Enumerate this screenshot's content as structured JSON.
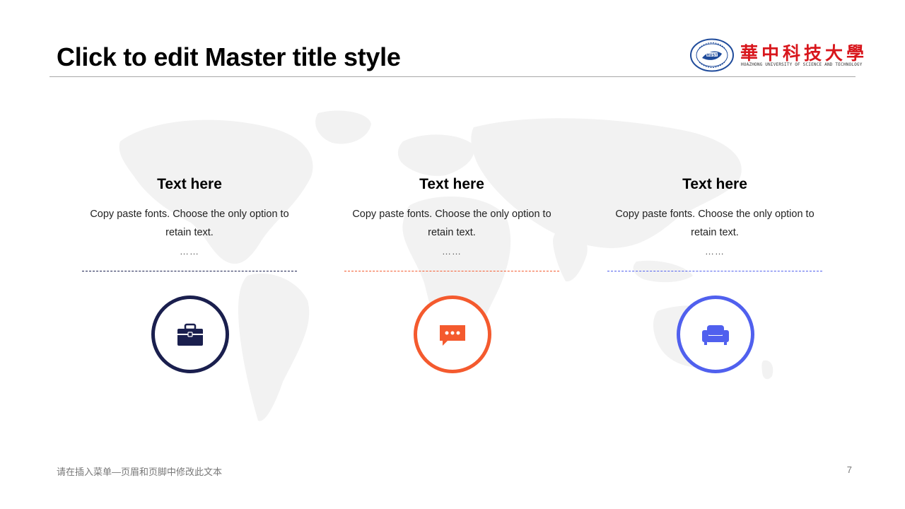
{
  "slide": {
    "title": "Click to edit Master title style",
    "logo": {
      "name_cn": "華中科技大學",
      "name_en": "HUAZHONG UNIVERSITY OF SCIENCE AND TECHNOLOGY",
      "seal_text": "HUST"
    },
    "columns": [
      {
        "heading": "Text here",
        "body": "Copy paste fonts. Choose the only option to retain text.",
        "ellipsis": "……",
        "icon": "briefcase-icon",
        "color": "#1a1f4e"
      },
      {
        "heading": "Text here",
        "body": "Copy paste fonts. Choose the only option to retain text.",
        "ellipsis": "……",
        "icon": "chat-bubble-icon",
        "color": "#f45a2e"
      },
      {
        "heading": "Text here",
        "body": "Copy paste fonts. Choose the only option to retain text.",
        "ellipsis": "……",
        "icon": "sofa-icon",
        "color": "#5060ee"
      }
    ],
    "footer": {
      "text": "请在插入菜单—页眉和页脚中修改此文本",
      "page_number": "7"
    },
    "colors": {
      "title_rule": "#a8a8a8",
      "logo_red": "#d8161c",
      "map": "#f2f2f2"
    }
  }
}
